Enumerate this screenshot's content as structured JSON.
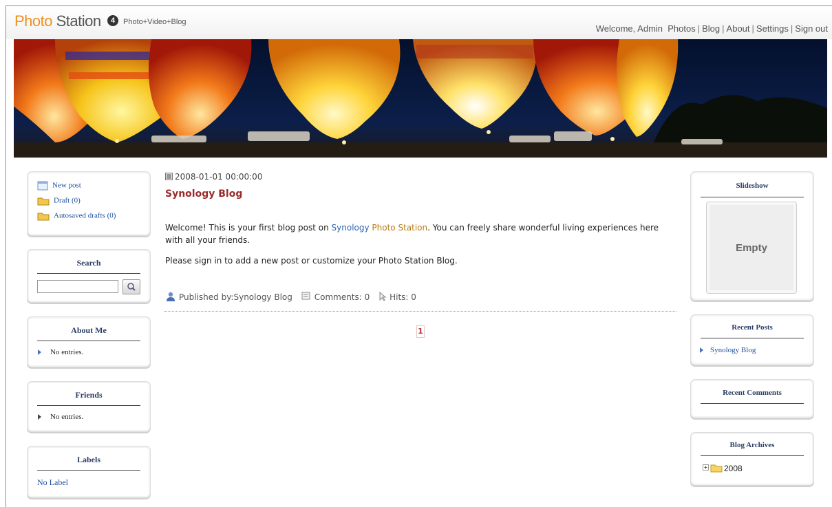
{
  "header": {
    "logo_photo": "Photo",
    "logo_station": "Station",
    "version": "4",
    "tagline": "Photo+Video+Blog",
    "welcome": "Welcome, Admin",
    "nav": [
      "Photos",
      "Blog",
      "About",
      "Settings",
      "Sign out"
    ]
  },
  "left": {
    "actions": [
      {
        "label": "New post",
        "icon": "new-post-icon"
      },
      {
        "label": "Draft (0)",
        "icon": "folder-icon"
      },
      {
        "label": "Autosaved drafts (0)",
        "icon": "folder-icon"
      }
    ],
    "search_title": "Search",
    "search_value": "",
    "about_title": "About Me",
    "about_text": "No entries.",
    "friends_title": "Friends",
    "friends_text": "No entries.",
    "labels_title": "Labels",
    "labels_text": "No Label"
  },
  "post": {
    "date": "2008-01-01 00:00:00",
    "title": "Synology Blog",
    "p1_a": "Welcome! This is your first blog post on ",
    "p1_b": "Synology",
    "p1_c": "Photo Station",
    "p1_d": ". You can freely share wonderful living experiences here with all your friends.",
    "p2": "Please sign in to add a new post or customize your Photo Station Blog.",
    "published": "Published by:Synology Blog",
    "comments": "Comments: 0",
    "hits": "Hits: 0",
    "page": "1"
  },
  "right": {
    "slideshow_title": "Slideshow",
    "slideshow_empty": "Empty",
    "recent_posts_title": "Recent Posts",
    "recent_posts": [
      "Synology Blog"
    ],
    "recent_comments_title": "Recent Comments",
    "archives_title": "Blog Archives",
    "archives": [
      "2008"
    ]
  },
  "colors": {
    "brand_orange": "#f0901e",
    "link_blue": "#1e4fa0",
    "title_red": "#9a2a2a"
  }
}
